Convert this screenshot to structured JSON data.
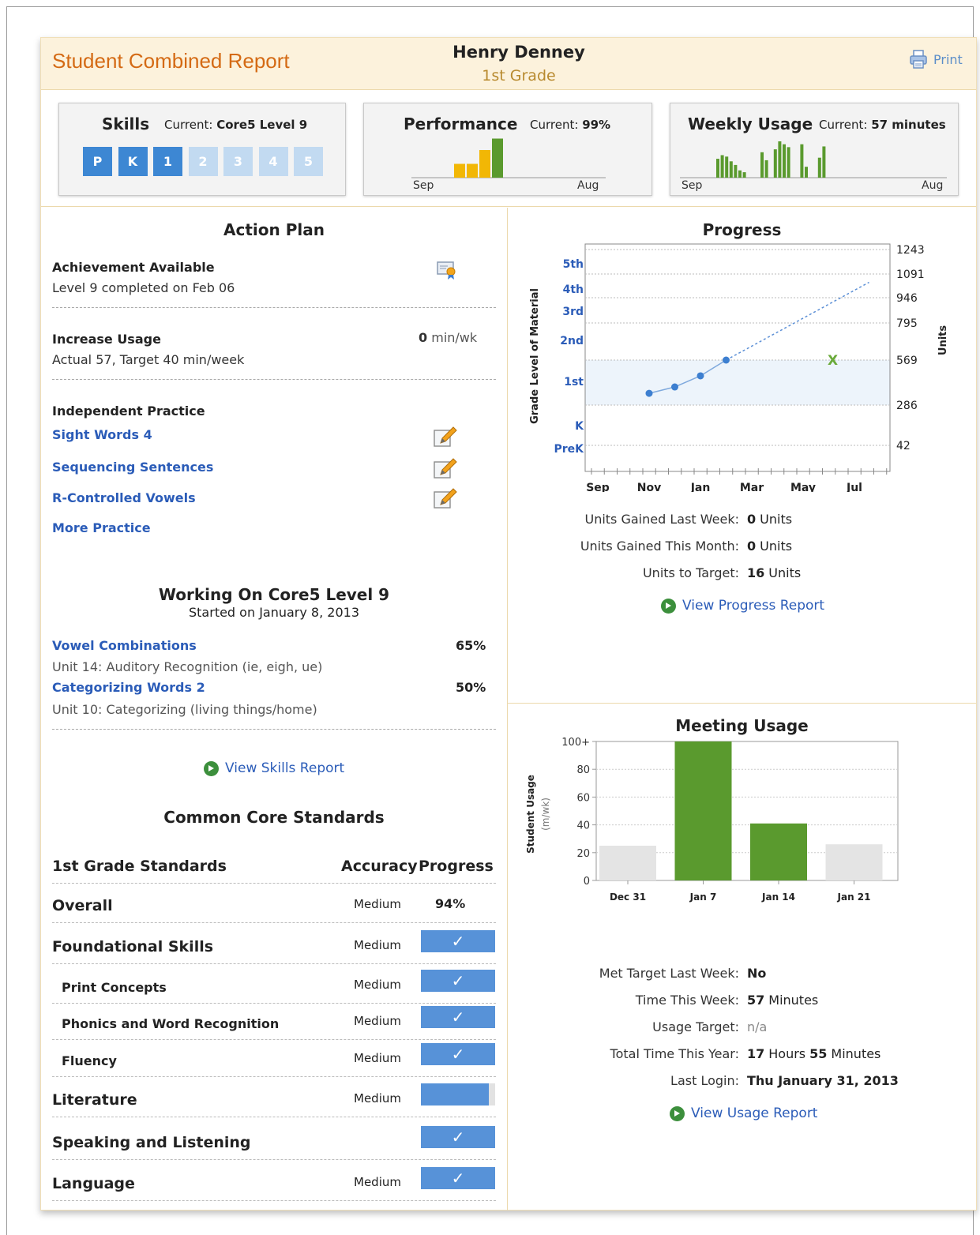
{
  "header": {
    "title": "Student Combined Report",
    "student_name": "Henry Denney",
    "grade": "1st Grade",
    "print_label": "Print"
  },
  "skills_card": {
    "title": "Skills",
    "current_label": "Current:",
    "current_value": "Core5 Level 9",
    "levels": [
      {
        "label": "P",
        "completed": true
      },
      {
        "label": "K",
        "completed": true
      },
      {
        "label": "1",
        "completed": true
      },
      {
        "label": "2",
        "completed": false
      },
      {
        "label": "3",
        "completed": false
      },
      {
        "label": "4",
        "completed": false
      },
      {
        "label": "5",
        "completed": false
      }
    ]
  },
  "performance_card": {
    "title": "Performance",
    "current_label": "Current:",
    "current_value": "99%",
    "x_start": "Sep",
    "x_end": "Aug"
  },
  "usage_card": {
    "title": "Weekly Usage",
    "current_label": "Current:",
    "current_value": "57 minutes",
    "x_start": "Sep",
    "x_end": "Aug"
  },
  "action_plan": {
    "title": "Action Plan",
    "achievement_label": "Achievement Available",
    "achievement_text": "Level 9 completed on Feb 06",
    "increase_usage_label": "Increase Usage",
    "increase_usage_value": "0",
    "increase_usage_unit": "min/wk",
    "increase_usage_text": "Actual 57, Target 40 min/week",
    "independent_practice_label": "Independent Practice",
    "practice_items": [
      "Sight Words 4",
      "Sequencing Sentences",
      "R-Controlled Vowels"
    ],
    "more_practice": "More Practice"
  },
  "working_on": {
    "title": "Working On Core5 Level 9",
    "started": "Started on January 8, 2013",
    "items": [
      {
        "name": "Vowel Combinations",
        "pct": "65%",
        "unit": "Unit 14: Auditory Recognition (ie, eigh, ue)"
      },
      {
        "name": "Categorizing Words 2",
        "pct": "50%",
        "unit": "Unit 10: Categorizing (living things/home)"
      }
    ],
    "view_link": "View Skills Report"
  },
  "ccs": {
    "title": "Common Core Standards",
    "header_name": "1st Grade Standards",
    "header_accuracy": "Accuracy",
    "header_progress": "Progress",
    "check": "✓",
    "rows": [
      {
        "name": "Overall",
        "accuracy": "Medium",
        "progress_text": "94%",
        "type": "pct",
        "sub": false
      },
      {
        "name": "Foundational Skills",
        "accuracy": "Medium",
        "type": "check",
        "sub": false
      },
      {
        "name": "Print Concepts",
        "accuracy": "Medium",
        "type": "check",
        "sub": true
      },
      {
        "name": "Phonics and Word Recognition",
        "accuracy": "Medium",
        "type": "check",
        "sub": true
      },
      {
        "name": "Fluency",
        "accuracy": "Medium",
        "type": "check",
        "sub": true
      },
      {
        "name": "Literature",
        "accuracy": "Medium",
        "type": "partial",
        "sub": false
      },
      {
        "name": "Speaking and Listening",
        "accuracy": "",
        "type": "check",
        "sub": false
      },
      {
        "name": "Language",
        "accuracy": "Medium",
        "type": "check",
        "sub": false
      }
    ]
  },
  "progress": {
    "title": "Progress",
    "stats": [
      {
        "label": "Units Gained Last Week:",
        "value": "0",
        "unit": "Units"
      },
      {
        "label": "Units Gained This Month:",
        "value": "0",
        "unit": "Units"
      },
      {
        "label": "Units to Target:",
        "value": "16",
        "unit": "Units"
      }
    ],
    "view_link": "View Progress Report"
  },
  "meeting_usage": {
    "title": "Meeting Usage",
    "stats": [
      {
        "label": "Met Target Last Week:",
        "value": "No",
        "unit": ""
      },
      {
        "label": "Time This Week:",
        "value": "57",
        "unit": "Minutes"
      },
      {
        "label": "Usage Target:",
        "value": "",
        "unit": "n/a"
      },
      {
        "label": "Total Time This Year:",
        "value": "17",
        "unit": "Hours",
        "value2": "55",
        "unit2": "Minutes"
      },
      {
        "label": "Last Login:",
        "value": "Thu January 31, 2013",
        "unit": ""
      }
    ],
    "view_link": "View Usage Report"
  },
  "colors": {
    "accent_orange": "#d46a14",
    "link_blue": "#2b5cb8",
    "level_on": "#3d87d3",
    "level_off": "#c2daf1",
    "bar_green": "#5a9a2e",
    "bar_yellow": "#f2b705",
    "bar_grey": "#e4e4e4"
  },
  "chart_data": [
    {
      "type": "bar",
      "title": "Performance",
      "categories": [
        "1",
        "2",
        "3",
        "4"
      ],
      "values": [
        35,
        35,
        70,
        99
      ],
      "colors": [
        "#f2b705",
        "#f2b705",
        "#f2b705",
        "#5a9a2e"
      ],
      "x_start": "Sep",
      "x_end": "Aug",
      "ylim": [
        0,
        100
      ]
    },
    {
      "type": "bar",
      "title": "Weekly Usage",
      "values": [
        52,
        62,
        58,
        45,
        35,
        20,
        15,
        0,
        0,
        0,
        70,
        48,
        0,
        78,
        100,
        92,
        84,
        0,
        0,
        92,
        30,
        0,
        0,
        55,
        86
      ],
      "x_start": "Sep",
      "x_end": "Aug",
      "ylim": [
        0,
        100
      ]
    },
    {
      "type": "line",
      "title": "Progress",
      "x_ticks": [
        "Sep",
        "Nov",
        "Jan",
        "Mar",
        "May",
        "Jul"
      ],
      "y_left_ticks": [
        "5th",
        "4th",
        "3rd",
        "2nd",
        "1st",
        "K",
        "PreK"
      ],
      "y_left_label": "Grade Level of Material",
      "y_right_ticks": [
        "1243",
        "1091",
        "946",
        "795",
        "569",
        "286",
        "42"
      ],
      "y_right_label": "Units",
      "grid": true,
      "series": [
        {
          "values": [
            {
              "x": "Nov",
              "y": 360
            },
            {
              "x": "Dec",
              "y": 400
            },
            {
              "x": "Jan",
              "y": 470
            },
            {
              "x": "Feb",
              "y": 569
            }
          ]
        }
      ],
      "projection": [
        {
          "x": "Feb",
          "y": 569
        },
        {
          "x": "Aug",
          "y": 1040
        }
      ],
      "target": {
        "x": "Jun",
        "y": 569,
        "marker": "X"
      }
    },
    {
      "type": "bar",
      "title": "Meeting Usage",
      "categories": [
        "Dec 31",
        "Jan 7",
        "Jan 14",
        "Jan 21"
      ],
      "values": [
        25,
        100,
        41,
        26
      ],
      "colors": [
        "#e4e4e4",
        "#5a9a2e",
        "#5a9a2e",
        "#e4e4e4"
      ],
      "ylabel": "Student Usage",
      "ylabel_unit": "(m/wk)",
      "y_ticks": [
        "0",
        "20",
        "40",
        "60",
        "80",
        "100+"
      ],
      "ylim": [
        0,
        100
      ]
    }
  ]
}
